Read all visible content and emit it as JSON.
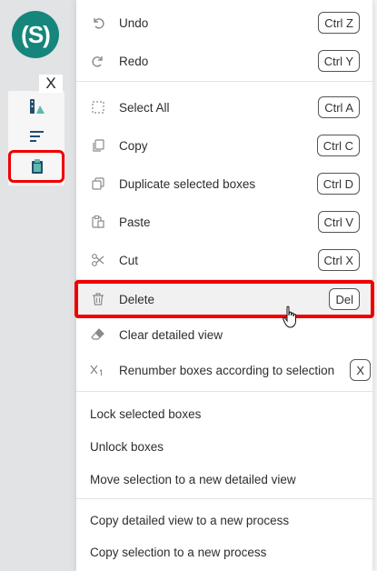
{
  "logo": {
    "text": "(S)"
  },
  "toolbar": {
    "close_label": "X"
  },
  "menu": {
    "items": [
      {
        "label": "Undo",
        "shortcut": "Ctrl Z",
        "icon": "undo-icon"
      },
      {
        "label": "Redo",
        "shortcut": "Ctrl Y",
        "icon": "redo-icon"
      },
      {
        "label": "Select All",
        "shortcut": "Ctrl A",
        "icon": "select-all-icon"
      },
      {
        "label": "Copy",
        "shortcut": "Ctrl C",
        "icon": "copy-icon"
      },
      {
        "label": "Duplicate selected boxes",
        "shortcut": "Ctrl D",
        "icon": "duplicate-icon"
      },
      {
        "label": "Paste",
        "shortcut": "Ctrl V",
        "icon": "paste-icon"
      },
      {
        "label": "Cut",
        "shortcut": "Ctrl X",
        "icon": "cut-icon"
      },
      {
        "label": "Delete",
        "shortcut": "Del",
        "icon": "trash-icon"
      },
      {
        "label": "Clear detailed view",
        "icon": "eraser-icon"
      },
      {
        "label": "Renumber boxes according to selection",
        "shortcut": "X",
        "icon": "renumber-icon"
      },
      {
        "label": "Lock selected boxes"
      },
      {
        "label": "Unlock boxes"
      },
      {
        "label": "Move selection to a new detailed view"
      },
      {
        "label": "Copy detailed view to a new process"
      },
      {
        "label": "Copy selection to a new process"
      }
    ]
  },
  "colors": {
    "brand": "#16867c",
    "highlight": "#e00000",
    "hover": "#f1f1f1"
  }
}
